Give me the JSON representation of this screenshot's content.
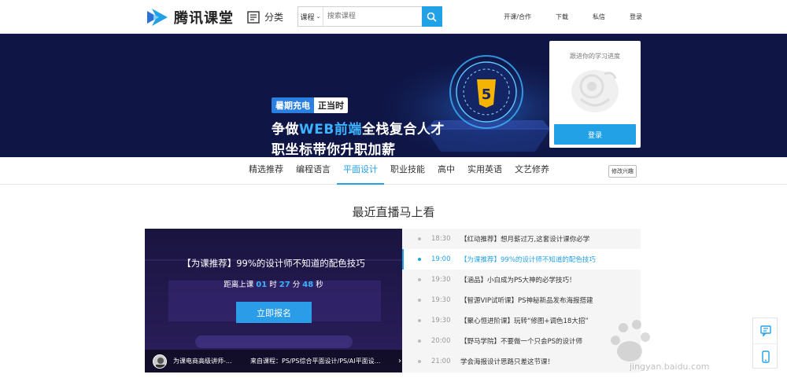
{
  "header": {
    "logo_text": "腾讯课堂",
    "category_label": "分类",
    "search": {
      "scope": "课程",
      "placeholder": "搜索课程"
    },
    "links": [
      "开课/合作",
      "下载",
      "私信",
      "登录"
    ]
  },
  "banner": {
    "tag_a": "暑期充电",
    "tag_b": "正当时",
    "line1_pre": "争做",
    "line1_hl": "WEB前端",
    "line1_post": "全栈复合人才",
    "line2": "职坐标带你升职加薪",
    "progress_title": "跟进你的学习进度",
    "login_label": "登录"
  },
  "nav": {
    "items": [
      "精选推荐",
      "编程语言",
      "平面设计",
      "职业技能",
      "高中",
      "实用英语",
      "文艺修养"
    ],
    "active_index": 2,
    "edit_label": "修改兴趣"
  },
  "section": {
    "title": "最近直播马上看"
  },
  "live": {
    "title": "【为课推荐】99%的设计师不知道的配色技巧",
    "countdown_label": "距离上课",
    "days": "01",
    "days_unit": "时",
    "minutes": "27",
    "minutes_unit": "分",
    "seconds": "48",
    "seconds_unit": "秒",
    "enroll_label": "立即报名",
    "teacher": "为课电商高级讲师-...",
    "course": "来自课程：PS/PS综合平面设计/PS/AI平面设...",
    "arrow": "›"
  },
  "schedule": [
    {
      "time": "18:30",
      "title": "【红动推荐】想月薪过万,这套设计课你必学",
      "active": false
    },
    {
      "time": "19:00",
      "title": "【为课推荐】99%的设计师不知道的配色技巧",
      "active": true
    },
    {
      "time": "19:30",
      "title": "【涵品】小白成为PS大神的必学技巧！",
      "active": false
    },
    {
      "time": "19:30",
      "title": "【智源VIP试听课】PS神秘新品发布海报搭建",
      "active": false
    },
    {
      "time": "19:30",
      "title": "【聚心恒进阶课】玩转“修图+调色18大招”",
      "active": false
    },
    {
      "time": "20:00",
      "title": "【野马学院】不要做一个只会PS的设计师",
      "active": false
    },
    {
      "time": "21:00",
      "title": "学会海报设计思路只差这节课！",
      "active": false
    }
  ],
  "watermark": {
    "text": "jingyan.baidu.com"
  },
  "colors": {
    "accent": "#23a1e6",
    "banner_bg": "#0f1646",
    "live_bg": "#221a45"
  }
}
